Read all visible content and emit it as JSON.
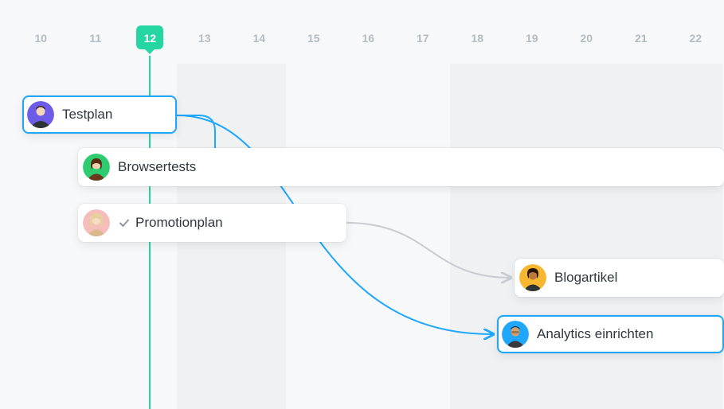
{
  "timeline": {
    "days": [
      "10",
      "11",
      "12",
      "13",
      "14",
      "15",
      "16",
      "17",
      "18",
      "19",
      "20",
      "21",
      "22"
    ],
    "selected_index": 2
  },
  "shaded_columns": [
    3,
    4,
    8,
    9,
    10,
    11,
    12
  ],
  "tasks": {
    "testplan": {
      "label": "Testplan",
      "avatar_color": "#6c5ce7",
      "selected": true,
      "completed": false
    },
    "browser": {
      "label": "Browsertests",
      "avatar_color": "#2ecc71",
      "selected": false,
      "completed": false
    },
    "promo": {
      "label": "Promotionplan",
      "avatar_color": "#f5b8b8",
      "selected": false,
      "completed": true
    },
    "blog": {
      "label": "Blogartikel",
      "avatar_color": "#f7b731",
      "selected": false,
      "completed": false
    },
    "analytics": {
      "label": "Analytics einrichten",
      "avatar_color": "#1ea7fd",
      "selected": true,
      "completed": false
    }
  },
  "colors": {
    "accent_teal": "#25d6a2",
    "accent_blue": "#1ea7fd",
    "connector_grey": "#c8ccd1"
  }
}
